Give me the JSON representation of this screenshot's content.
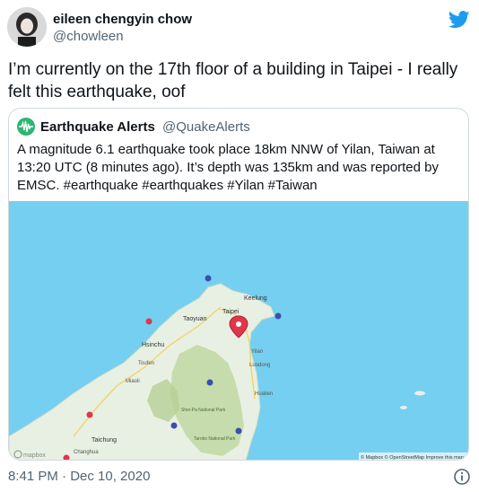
{
  "tweet": {
    "author_name": "eileen chengyin chow",
    "author_handle": "@chowleen",
    "text": "I’m currently on the 17th floor of a building in Taipei - I really felt this earthquake, oof",
    "timestamp": "8:41 PM · Dec 10, 2020"
  },
  "quoted": {
    "name": "Earthquake Alerts",
    "handle": "@QuakeAlerts",
    "text": "A magnitude 6.1 earthquake took place 18km NNW of Yilan, Taiwan at 13:20 UTC (8 minutes ago). It’s depth was 135km and was reported by EMSC. #earthquake #earthquakes #Yilan #Taiwan"
  },
  "map": {
    "labels": {
      "keelung": "Keelung",
      "taipei": "Taipei",
      "taoyuan": "Taoyuan",
      "hsinchu": "Hsinchu",
      "yilan": "Yilan",
      "luodong": "Luodong",
      "toufen": "Toufen",
      "miaoli": "Miaoli",
      "hualien": "Hualien",
      "taichung": "Taichung",
      "changhua": "Changhua",
      "shei_pa": "Shei-Pa National Park",
      "taroko": "Taroko National Park"
    },
    "attribution": "© Mapbox © OpenStreetMap Improve this map",
    "logo": "mapbox"
  },
  "colors": {
    "sea": "#75cff0",
    "land": "#e8f0e3",
    "park": "#c3d9a6",
    "pin": "#e0364b",
    "brand": "#1d9bf0"
  }
}
